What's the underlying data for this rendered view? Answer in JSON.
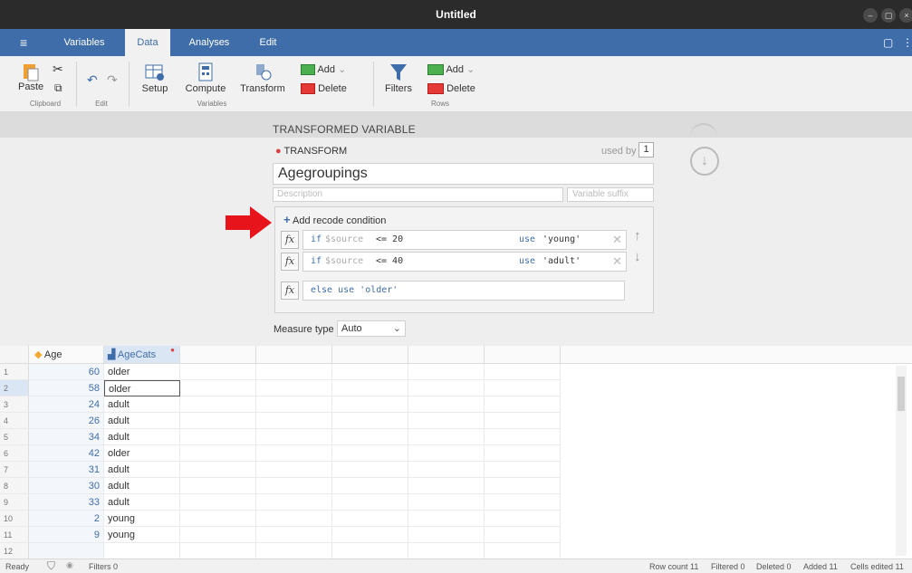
{
  "window": {
    "title": "Untitled",
    "controls": [
      "–",
      "▢",
      "×"
    ]
  },
  "menu": {
    "tabs": [
      "Variables",
      "Data",
      "Analyses",
      "Edit"
    ],
    "active": "Data"
  },
  "ribbon": {
    "paste": "Paste",
    "clipboard": "Clipboard",
    "edit": "Edit",
    "setup": "Setup",
    "compute": "Compute",
    "transform": "Transform",
    "variables": "Variables",
    "add": "Add",
    "delete": "Delete",
    "filters": "Filters",
    "rows": "Rows"
  },
  "transform": {
    "header": "TRANSFORMED VARIABLE",
    "label": "TRANSFORM",
    "used_by_label": "used by",
    "used_by_count": "1",
    "name": "Agegroupings",
    "description_placeholder": "Description",
    "suffix_placeholder": "Variable suffix",
    "add_condition": "Add recode condition",
    "conditions": [
      {
        "if_kw": "if",
        "source": "$source",
        "op": "<= 20",
        "use_kw": "use",
        "value": "'young'"
      },
      {
        "if_kw": "if",
        "source": "$source",
        "op": "<= 40",
        "use_kw": "use",
        "value": "'adult'"
      }
    ],
    "else_text": "else use 'older'",
    "measure_label": "Measure type",
    "measure_value": "Auto"
  },
  "grid": {
    "columns": [
      "Age",
      "AgeCats"
    ],
    "rows": [
      {
        "n": "1",
        "age": "60",
        "cat": "older"
      },
      {
        "n": "2",
        "age": "58",
        "cat": "older"
      },
      {
        "n": "3",
        "age": "24",
        "cat": "adult"
      },
      {
        "n": "4",
        "age": "26",
        "cat": "adult"
      },
      {
        "n": "5",
        "age": "34",
        "cat": "adult"
      },
      {
        "n": "6",
        "age": "42",
        "cat": "older"
      },
      {
        "n": "7",
        "age": "31",
        "cat": "adult"
      },
      {
        "n": "8",
        "age": "30",
        "cat": "adult"
      },
      {
        "n": "9",
        "age": "33",
        "cat": "adult"
      },
      {
        "n": "10",
        "age": "2",
        "cat": "young"
      },
      {
        "n": "11",
        "age": "9",
        "cat": "young"
      },
      {
        "n": "12",
        "age": "",
        "cat": ""
      }
    ]
  },
  "status": {
    "ready": "Ready",
    "filters": "Filters 0",
    "row_count": "Row count 11",
    "filtered": "Filtered 0",
    "deleted": "Deleted 0",
    "added": "Added 11",
    "cells_edited": "Cells edited 11"
  },
  "colors": {
    "menu": "#3e6da9",
    "arrow": "#e8141c",
    "accent": "#3e6da9"
  }
}
